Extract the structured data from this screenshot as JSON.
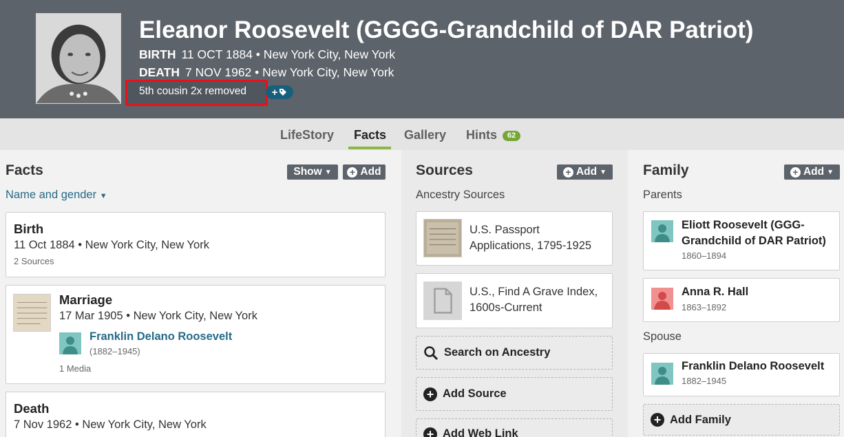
{
  "person": {
    "name": "Eleanor Roosevelt (GGGG-Grandchild of DAR Patriot)",
    "birth_label": "BIRTH",
    "birth_value": "11 OCT 1884 • New York City, New York",
    "death_label": "DEATH",
    "death_value": "7 NOV 1962 • New York City, New York",
    "relationship": "5th cousin 2x removed",
    "tag_button_icon": "plus-tag-icon"
  },
  "tabs": [
    {
      "label": "LifeStory"
    },
    {
      "label": "Facts"
    },
    {
      "label": "Gallery"
    },
    {
      "label": "Hints",
      "badge": "62"
    }
  ],
  "facts": {
    "title": "Facts",
    "show_label": "Show",
    "add_label": "Add",
    "filter_label": "Name and gender",
    "items": [
      {
        "title": "Birth",
        "detail": "11 Oct 1884 • New York City, New York",
        "meta": "2 Sources"
      },
      {
        "title": "Marriage",
        "detail": "17 Mar 1905 • New York City, New York",
        "spouse": "Franklin Delano Roosevelt",
        "spouse_years": "(1882–1945)",
        "meta": "1 Media"
      },
      {
        "title": "Death",
        "detail": "7 Nov 1962 • New York City, New York"
      }
    ]
  },
  "sources": {
    "title": "Sources",
    "add_label": "Add",
    "subtitle": "Ancestry Sources",
    "items": [
      {
        "line1": "U.S. Passport",
        "line2": "Applications, 1795-1925"
      },
      {
        "line1": "U.S., Find A Grave Index,",
        "line2": "1600s-Current"
      }
    ],
    "search_label": "Search on Ancestry",
    "add_source_label": "Add Source",
    "add_web_link_label": "Add Web Link"
  },
  "family": {
    "title": "Family",
    "add_label": "Add",
    "parents_label": "Parents",
    "parents": [
      {
        "line1": "Eliott Roosevelt (GGG-",
        "line2": "Grandchild of DAR Patriot)",
        "years": "1860–1894",
        "gender": "male"
      },
      {
        "line1": "Anna R. Hall",
        "years": "1863–1892",
        "gender": "female"
      }
    ],
    "spouse_label": "Spouse",
    "spouse": {
      "name": "Franklin Delano Roosevelt",
      "years": "1882–1945",
      "gender": "male"
    },
    "add_family_label": "Add Family"
  },
  "colors": {
    "header_bg": "#5d636a",
    "link": "#276a87",
    "tab_active": "#8ab64a",
    "badge": "#76a636",
    "highlight": "#e8111b",
    "male_avatar": "#7fc6c1",
    "female_avatar": "#f2908f"
  }
}
